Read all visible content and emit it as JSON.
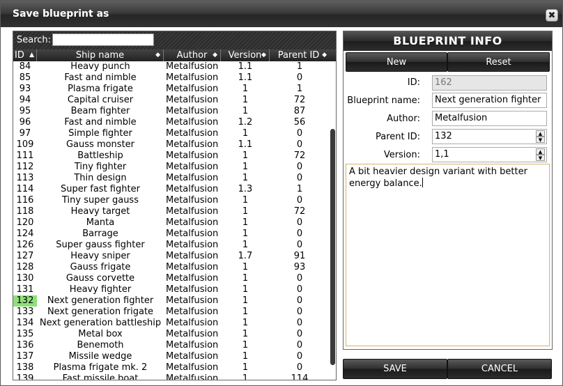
{
  "window": {
    "title": "Save blueprint as",
    "close_symbol": "✖"
  },
  "search": {
    "label": "Search:",
    "value": ""
  },
  "table": {
    "columns": {
      "id": "ID",
      "name": "Ship name",
      "author": "Author",
      "version": "Version",
      "parent_id": "Parent ID"
    },
    "rows": [
      {
        "id": "84",
        "name": "Heavy punch",
        "author": "Metalfusion",
        "version": "1.1",
        "parent_id": "1"
      },
      {
        "id": "85",
        "name": "Fast and nimble",
        "author": "Metalfusion",
        "version": "1.1",
        "parent_id": "0"
      },
      {
        "id": "93",
        "name": "Plasma frigate",
        "author": "Metalfusion",
        "version": "1",
        "parent_id": "1"
      },
      {
        "id": "94",
        "name": "Capital cruiser",
        "author": "Metalfusion",
        "version": "1",
        "parent_id": "72"
      },
      {
        "id": "95",
        "name": "Beam fighter",
        "author": "Metalfusion",
        "version": "1",
        "parent_id": "87"
      },
      {
        "id": "96",
        "name": "Fast and nimble",
        "author": "Metalfusion",
        "version": "1.2",
        "parent_id": "56"
      },
      {
        "id": "97",
        "name": "Simple fighter",
        "author": "Metalfusion",
        "version": "1",
        "parent_id": "0"
      },
      {
        "id": "109",
        "name": "Gauss monster",
        "author": "Metalfusion",
        "version": "1.1",
        "parent_id": "0"
      },
      {
        "id": "111",
        "name": "Battleship",
        "author": "Metalfusion",
        "version": "1",
        "parent_id": "72"
      },
      {
        "id": "112",
        "name": "Tiny fighter",
        "author": "Metalfusion",
        "version": "1",
        "parent_id": "0"
      },
      {
        "id": "113",
        "name": "Thin design",
        "author": "Metalfusion",
        "version": "1",
        "parent_id": "0"
      },
      {
        "id": "114",
        "name": "Super fast fighter",
        "author": "Metalfusion",
        "version": "1.3",
        "parent_id": "1"
      },
      {
        "id": "116",
        "name": "Tiny super gauss",
        "author": "Metalfusion",
        "version": "1",
        "parent_id": "0"
      },
      {
        "id": "118",
        "name": "Heavy target",
        "author": "Metalfusion",
        "version": "1",
        "parent_id": "72"
      },
      {
        "id": "120",
        "name": "Manta",
        "author": "Metalfusion",
        "version": "1",
        "parent_id": "0"
      },
      {
        "id": "124",
        "name": "Barrage",
        "author": "Metalfusion",
        "version": "1",
        "parent_id": "0"
      },
      {
        "id": "126",
        "name": "Super gauss fighter",
        "author": "Metalfusion",
        "version": "1",
        "parent_id": "0"
      },
      {
        "id": "127",
        "name": "Heavy sniper",
        "author": "Metalfusion",
        "version": "1.7",
        "parent_id": "91"
      },
      {
        "id": "128",
        "name": "Gauss frigate",
        "author": "Metalfusion",
        "version": "1",
        "parent_id": "93"
      },
      {
        "id": "130",
        "name": "Gauss corvette",
        "author": "Metalfusion",
        "version": "1",
        "parent_id": "0"
      },
      {
        "id": "131",
        "name": "Heavy fighter",
        "author": "Metalfusion",
        "version": "1",
        "parent_id": "0"
      },
      {
        "id": "132",
        "name": "Next generation fighter",
        "author": "Metalfusion",
        "version": "1",
        "parent_id": "0",
        "selected": true
      },
      {
        "id": "133",
        "name": "Next generation frigate",
        "author": "Metalfusion",
        "version": "1",
        "parent_id": "0"
      },
      {
        "id": "134",
        "name": "Next generation battleship",
        "author": "Metalfusion",
        "version": "1",
        "parent_id": "0"
      },
      {
        "id": "135",
        "name": "Metal box",
        "author": "Metalfusion",
        "version": "1",
        "parent_id": "0"
      },
      {
        "id": "136",
        "name": "Benemoth",
        "author": "Metalfusion",
        "version": "1",
        "parent_id": "0"
      },
      {
        "id": "137",
        "name": "Missile wedge",
        "author": "Metalfusion",
        "version": "1",
        "parent_id": "0"
      },
      {
        "id": "138",
        "name": "Plasma frigate mk. 2",
        "author": "Metalfusion",
        "version": "1",
        "parent_id": "0"
      },
      {
        "id": "139",
        "name": "Fast missile boat",
        "author": "Metalfusion",
        "version": "1",
        "parent_id": "114"
      }
    ]
  },
  "info": {
    "title": "BLUEPRINT INFO",
    "new_label": "New",
    "reset_label": "Reset",
    "id_label": "ID:",
    "id_value": "162",
    "name_label": "Blueprint name:",
    "name_value": "Next generation fighter",
    "author_label": "Author:",
    "author_value": "Metalfusion",
    "parent_label": "Parent ID:",
    "parent_value": "132",
    "version_label": "Version:",
    "version_value": "1,1",
    "description": "A bit heavier design variant with better energy balance."
  },
  "footer": {
    "save_label": "SAVE",
    "cancel_label": "CANCEL"
  },
  "icons": {
    "sort_asc": "▲",
    "sort_both": "◆",
    "spin_up": "▲",
    "spin_down": "▼"
  },
  "colors": {
    "selected_id_bg": "#8fe07a",
    "description_border": "#d7b16a"
  }
}
